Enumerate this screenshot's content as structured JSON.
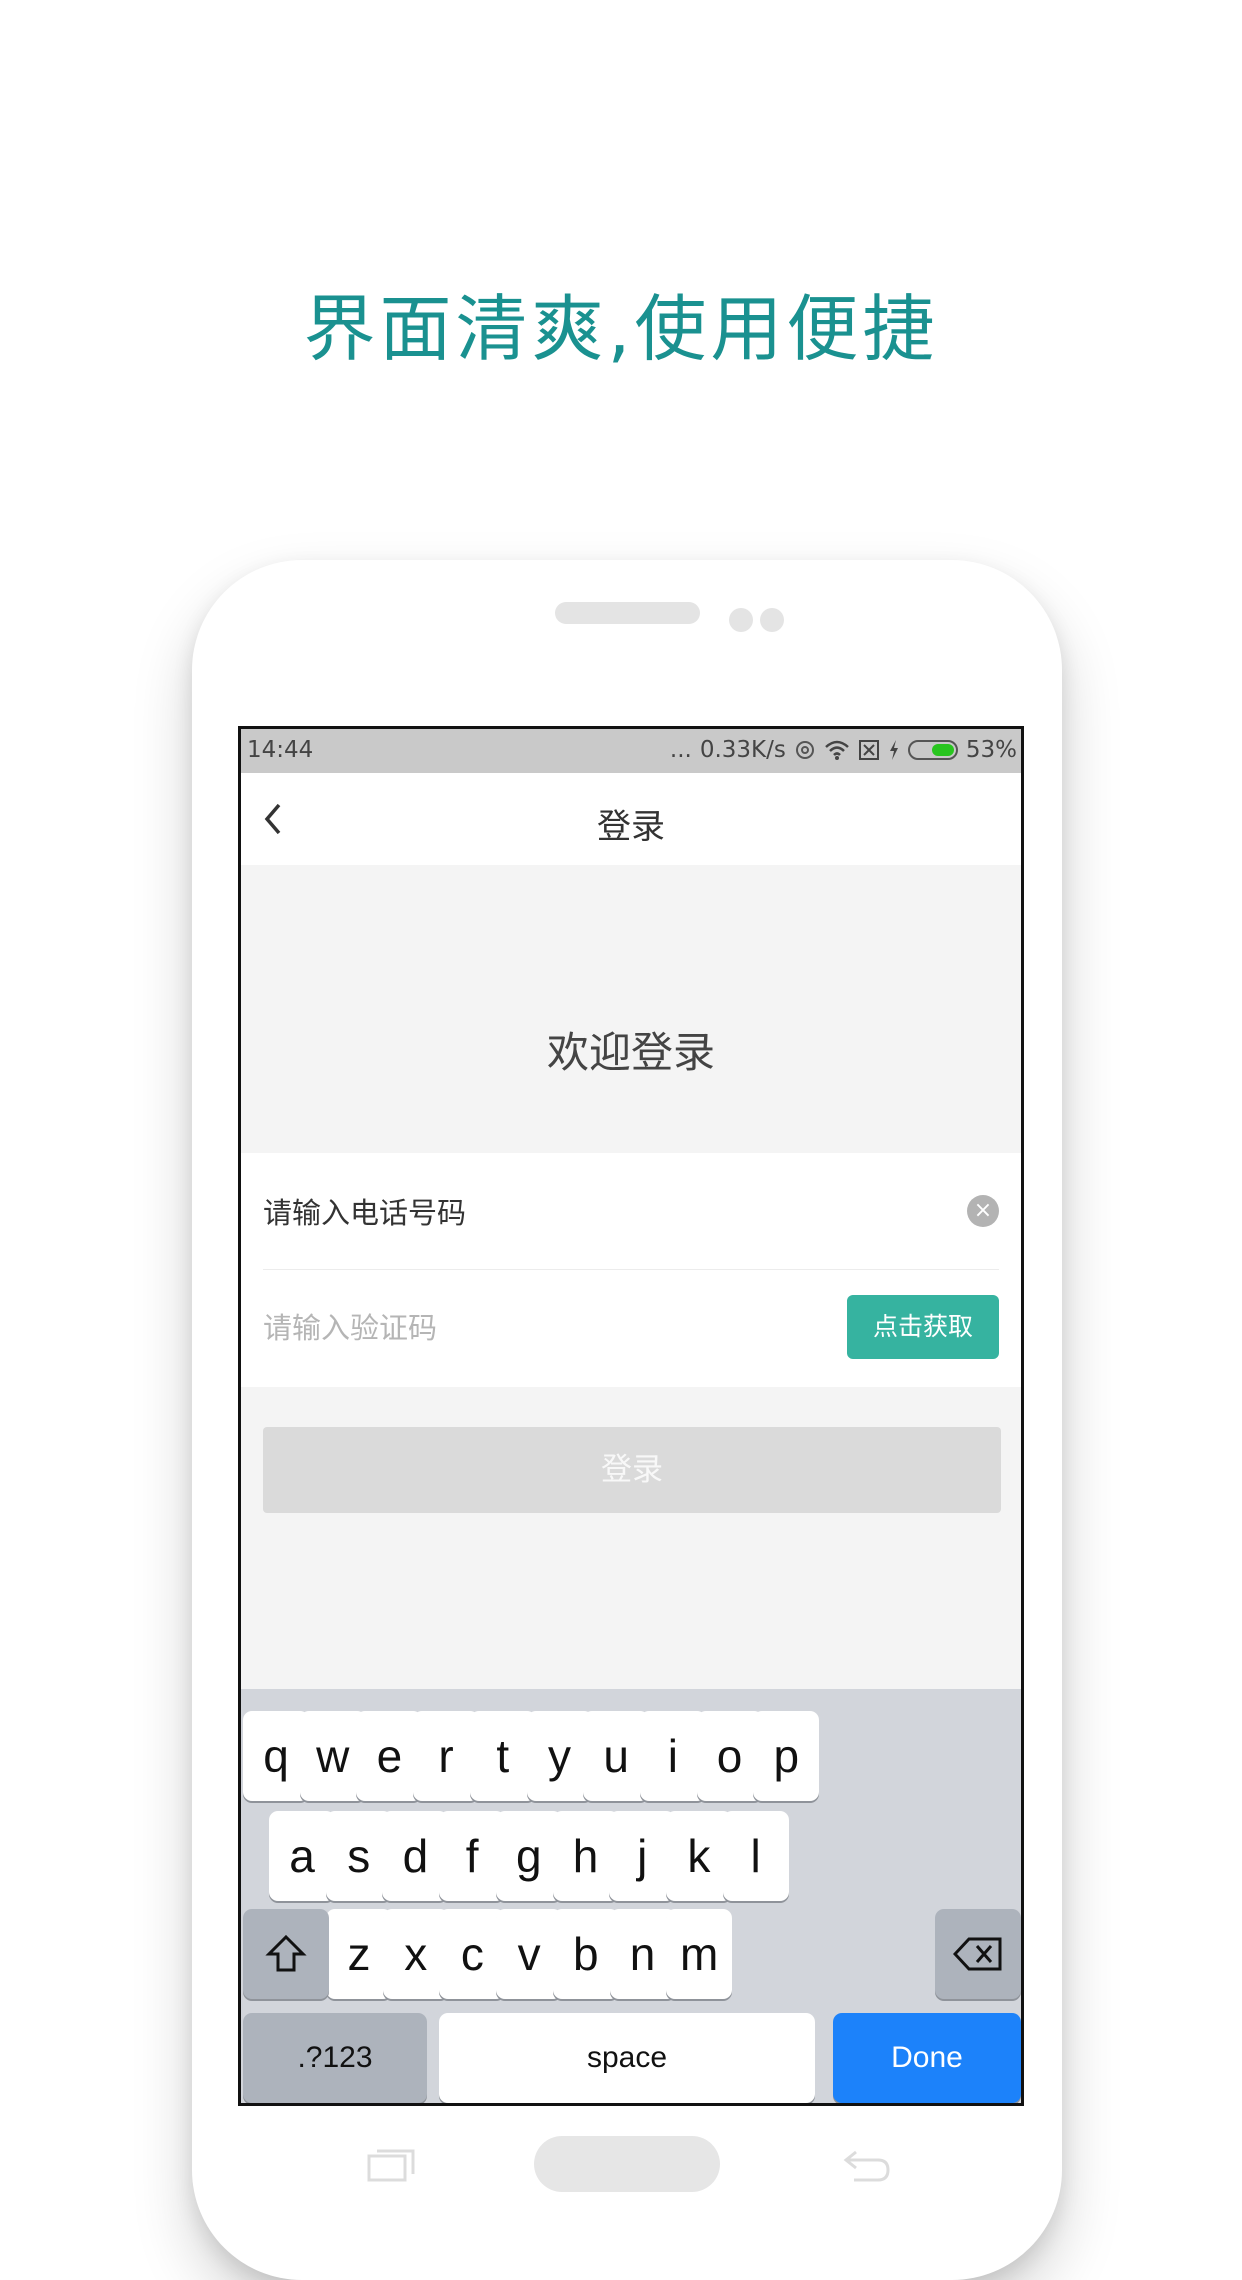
{
  "headline": "界面清爽,使用便捷",
  "status_bar": {
    "time": "14:44",
    "dots": "...",
    "speed": "0.33K/s",
    "battery": "53%",
    "battery_level": 0.53,
    "icons": [
      "alarm-icon",
      "wifi-icon",
      "no-sim-icon",
      "charging-icon",
      "battery-icon"
    ]
  },
  "nav": {
    "title": "登录",
    "back_icon": "chevron-left-icon"
  },
  "welcome": "欢迎登录",
  "form": {
    "phone_value": "请输入电话号码",
    "clear_icon": "clear-circle-icon",
    "code_placeholder": "请输入验证码",
    "code_button": "点击获取"
  },
  "login_button": "登录",
  "keyboard": {
    "row1": [
      "q",
      "w",
      "e",
      "r",
      "t",
      "y",
      "u",
      "i",
      "o",
      "p"
    ],
    "row2": [
      "a",
      "s",
      "d",
      "f",
      "g",
      "h",
      "j",
      "k",
      "l"
    ],
    "row3": [
      "z",
      "x",
      "c",
      "v",
      "b",
      "n",
      "m"
    ],
    "shift_icon": "shift-icon",
    "backspace_icon": "backspace-icon",
    "numbers": ".?123",
    "space": "space",
    "done": "Done"
  },
  "colors": {
    "accent": "#1a9190",
    "button": "#36b3a0",
    "done": "#1c82fa"
  }
}
